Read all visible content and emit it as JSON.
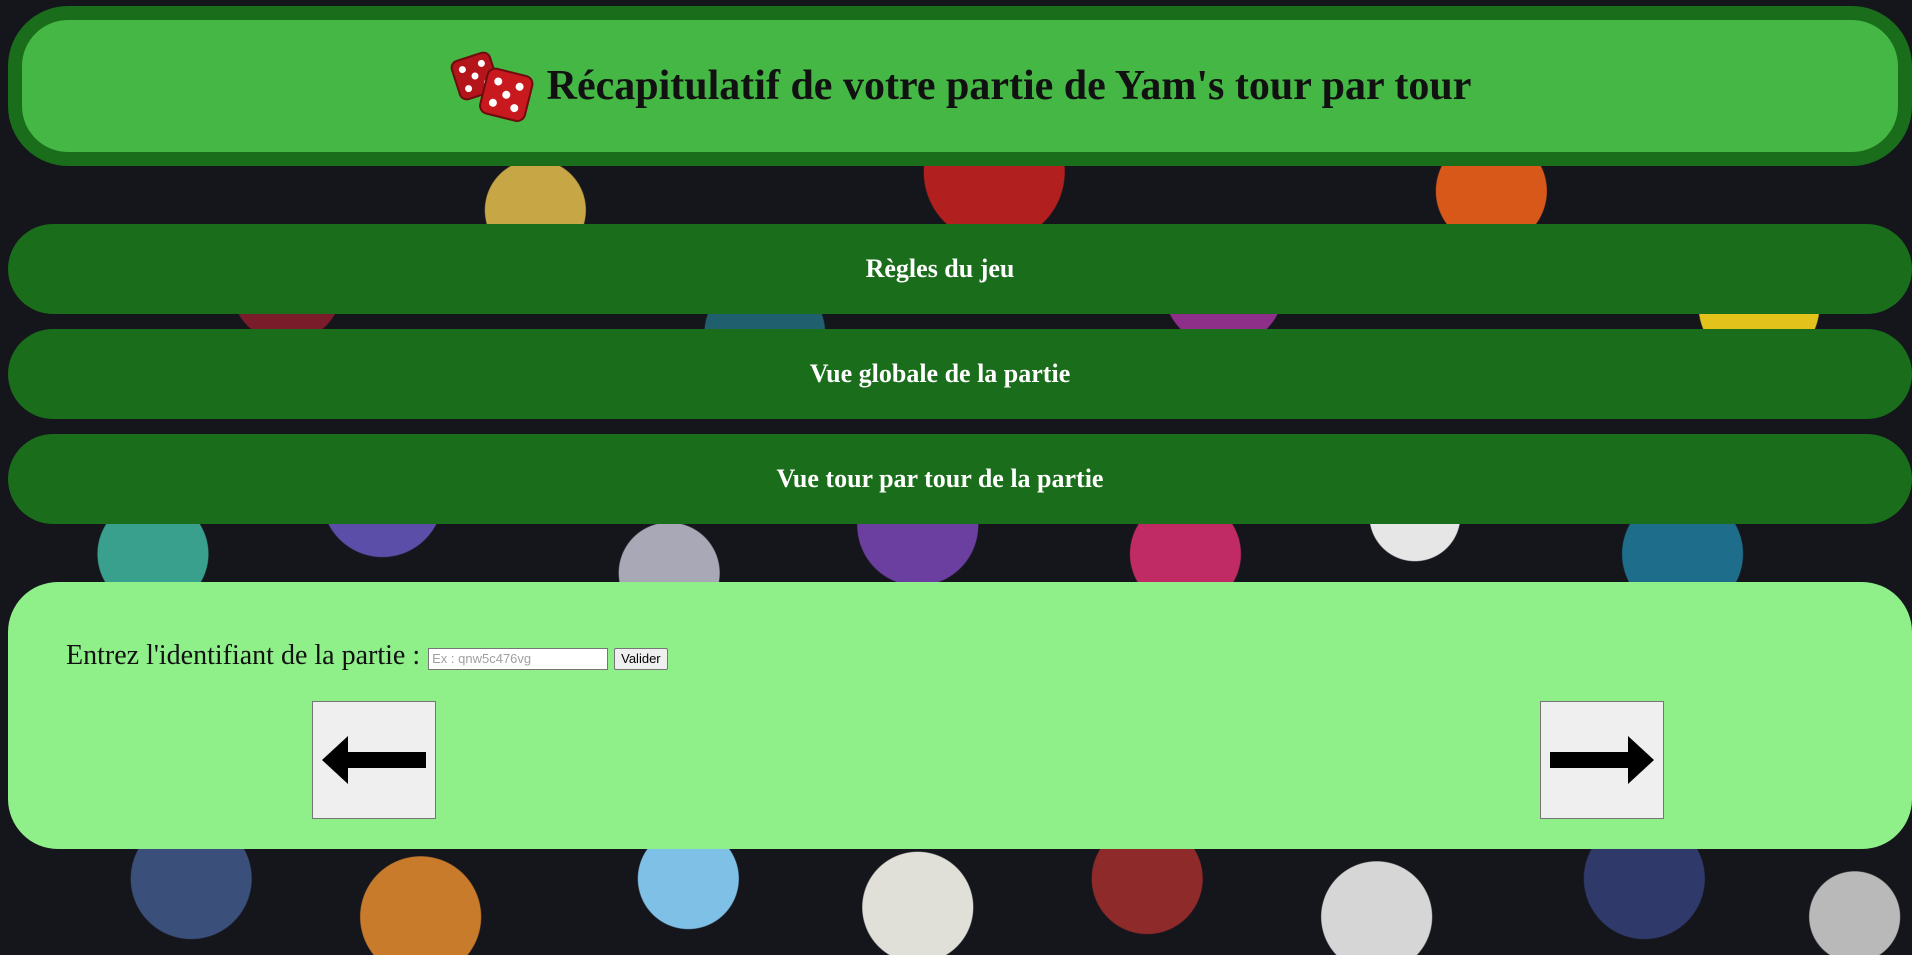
{
  "header": {
    "title": "Récapitulatif de votre partie de Yam's tour par tour",
    "icon": "dice-icon"
  },
  "nav": {
    "rules_label": "Règles du jeu",
    "global_label": "Vue globale de la partie",
    "turn_label": "Vue tour par tour de la partie"
  },
  "form": {
    "label": "Entrez l'identifiant de la partie :",
    "placeholder": "Ex : qnw5c476vg",
    "value": "",
    "submit_label": "Valider"
  },
  "navigation_arrows": {
    "prev_icon": "arrow-left-icon",
    "next_icon": "arrow-right-icon"
  },
  "colors": {
    "header_outer": "#1a6d1a",
    "header_inner": "#45b745",
    "nav_button": "#1a6d1a",
    "panel": "#8ff08a"
  }
}
